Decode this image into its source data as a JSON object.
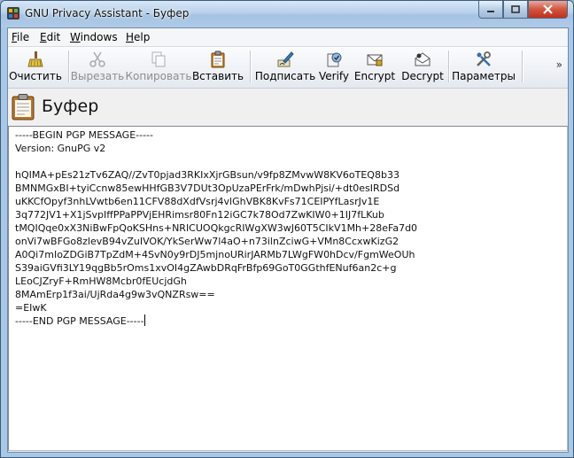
{
  "window": {
    "title": "GNU Privacy Assistant - Буфер"
  },
  "menu": [
    {
      "label": "File",
      "u": "F",
      "rest": "ile"
    },
    {
      "label": "Edit",
      "u": "E",
      "rest": "dit"
    },
    {
      "label": "Windows",
      "u": "W",
      "rest": "indows"
    },
    {
      "label": "Help",
      "u": "H",
      "rest": "elp"
    }
  ],
  "toolbar": {
    "clear": "Очистить",
    "cut": "Вырезать",
    "copy": "Копировать",
    "paste": "Вставить",
    "sign": "Подписать",
    "verify": "Verify",
    "encrypt": "Encrypt",
    "decrypt": "Decrypt",
    "settings": "Параметры",
    "more": "»"
  },
  "icons": {
    "clear": "broom-icon",
    "cut": "scissors-icon",
    "copy": "copy-icon",
    "paste": "clipboard-icon",
    "sign": "sign-pen-icon",
    "verify": "verify-seal-icon",
    "encrypt": "envelope-lock-icon",
    "decrypt": "envelope-open-icon",
    "settings": "tools-icon"
  },
  "header": {
    "title": "Буфер"
  },
  "clipboard": {
    "lines": [
      "-----BEGIN PGP MESSAGE-----",
      "Version: GnuPG v2",
      "",
      "hQIMA+pEs21zTv6ZAQ//ZvT0pjad3RKIxXjrGBsun/v9fp8ZMvwW8KV6oTEQ8b33",
      "BMNMGxBI+tyiCcnw85ewHHfGB3V7DUt3OpUzaPErFrk/mDwhPjsi/+dt0esIRDSd",
      "uKKCfOpyf3nhLVwtb6en11CFV88dXdfVsrj4vlGhVBK8KvFs71CEIPYfLasrJv1E",
      "3q772JV1+X1jSvpIffPPaPPVjEHRimsr80Fn12iGC7k78Od7ZwKIW0+1IJ7fLKub",
      "tMQIQqe0xX3NiBwFpQoKSHns+NRICUOQkgcRIWgXW3wJ60T5CIkV1Mh+28eFa7d0",
      "onVi7wBFGo8zlevB94vZuIVOK/YkSerWw7l4aO+n73ilnZciwG+VMn8CcxwKizG2",
      "A0Qi7mIoZDGiB7TpZdM+4SvN0y9rDJ5mjnoURirJARMb7LWgFW0hDcv/FgmWeOUh",
      "S39aiGVfi3LY19qgBb5rOms1xvOI4gZAwbDRqFrBfp69GoT0GGthfENuf6an2c+g",
      "LEoCJZryF+RmHW8Mcbr0fEUcjdGh",
      "8MAmErp1f3ai/UjRda4g9w3vQNZRsw==",
      "=EIwK",
      "-----END PGP MESSAGE-----"
    ]
  },
  "colors": {
    "titlebar": "#b7d0ea",
    "close": "#c1301a",
    "editor_bg": "#ffffff"
  }
}
